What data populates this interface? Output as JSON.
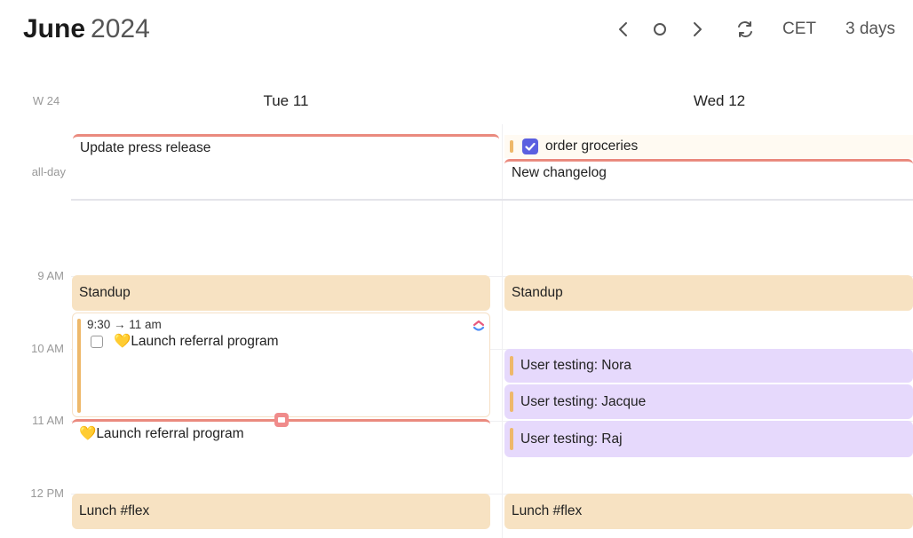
{
  "header": {
    "month": "June",
    "year": "2024",
    "prev_icon": "chevron-left-icon",
    "today_icon": "circle-icon",
    "next_icon": "chevron-right-icon",
    "refresh_icon": "refresh-icon",
    "timezone": "CET",
    "view": "3 days"
  },
  "week_label": "W 24",
  "allday_label": "all-day",
  "days": [
    {
      "label": "Tue 11"
    },
    {
      "label": "Wed 12"
    }
  ],
  "allday_events": {
    "tue": [
      {
        "title": "Update press release"
      }
    ],
    "wed": [
      {
        "title": "order groceries",
        "checked": true
      },
      {
        "title": "New changelog"
      }
    ]
  },
  "time_labels": [
    "9 AM",
    "10 AM",
    "11 AM",
    "12 PM"
  ],
  "events": {
    "tue": {
      "standup": "Standup",
      "referral_time": "9:30 → 11 am",
      "referral_title": "Launch referral program",
      "referral_emoji": "💛",
      "referral_task_title": "Launch referral program",
      "lunch": "Lunch #flex"
    },
    "wed": {
      "standup": "Standup",
      "testing": [
        "User testing: Nora",
        "User testing: Jacque",
        "User testing: Raj"
      ],
      "lunch": "Lunch #flex"
    }
  },
  "colors": {
    "orange_event": "#f7e2c2",
    "purple_event": "#e6d9fc",
    "accent_red": "#ea8a7e",
    "check_blue": "#5b5fe0"
  }
}
